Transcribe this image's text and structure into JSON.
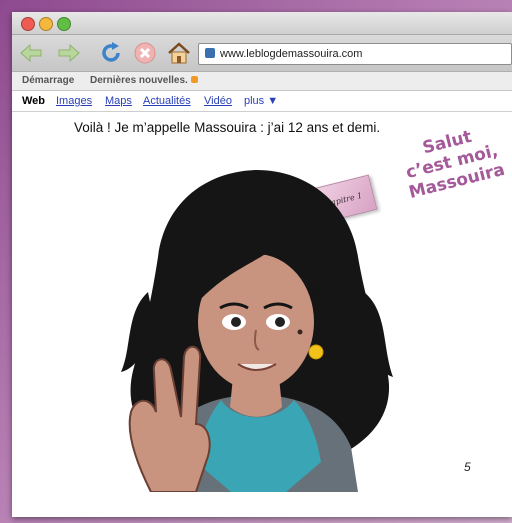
{
  "browser": {
    "url": "www.leblogdemassouira.com",
    "icons": {
      "back": "back-arrow-icon",
      "forward": "forward-arrow-icon",
      "reload": "reload-icon",
      "stop": "stop-icon",
      "home": "home-icon"
    }
  },
  "bookmarks": {
    "items": [
      "Démarrage",
      "Dernières nouvelles."
    ]
  },
  "search_nav": {
    "active": "Web",
    "links": [
      "Images",
      "Maps",
      "Actualités",
      "Vidéo"
    ],
    "more": "plus ▼"
  },
  "page": {
    "intro": "Voilà ! Je m’appelle Massouira : j’ai 12 ans et demi.",
    "note": "Chapitre 1",
    "title_lines": [
      "Salut",
      "c’est moi,",
      "Massouira"
    ],
    "page_number": "5"
  },
  "colors": {
    "title": "#a45a9a",
    "hair": "#151515",
    "skin": "#c89480",
    "shirt": "#3aa5b5",
    "vest": "#67717a",
    "earring": "#f2c21a"
  }
}
